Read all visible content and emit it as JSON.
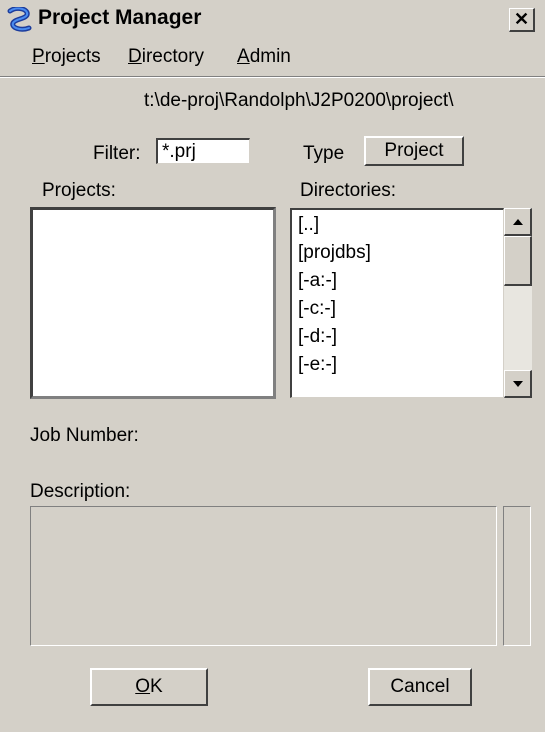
{
  "window": {
    "title": "Project Manager",
    "close_glyph": "✕",
    "app_icon": "project-manager-app-icon"
  },
  "menu": {
    "projects": {
      "accel": "P",
      "rest": "rojects"
    },
    "directory": {
      "accel": "D",
      "rest": "irectory"
    },
    "admin": {
      "accel": "A",
      "rest": "dmin"
    }
  },
  "path": "t:\\de-proj\\Randolph\\J2P0200\\project\\",
  "filter": {
    "label": "Filter:",
    "value": "*.prj"
  },
  "type": {
    "label": "Type",
    "button_label": "Project"
  },
  "projects_list": {
    "label": "Projects:",
    "items": []
  },
  "directories": {
    "label": "Directories:",
    "items": [
      "[..]",
      "[projdbs]",
      "[-a:-]",
      "[-c:-]",
      "[-d:-]",
      "[-e:-]"
    ]
  },
  "job_number": {
    "label": "Job Number:",
    "value": ""
  },
  "description": {
    "label": "Description:",
    "value": ""
  },
  "buttons": {
    "ok": {
      "accel": "O",
      "rest": "K"
    },
    "cancel": "Cancel"
  },
  "colors": {
    "face": "#d4d0c8",
    "window": "#ffffff"
  }
}
